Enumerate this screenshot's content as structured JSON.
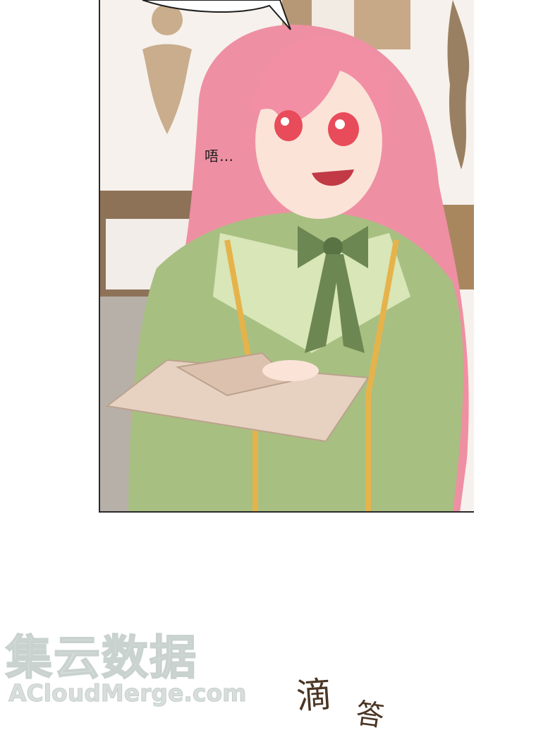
{
  "panel": {
    "mumble_text": "唔…"
  },
  "watermark": {
    "chinese": "集云数据",
    "english": "ACloudMerge.com"
  },
  "sfx": {
    "drip_1": "滴",
    "drip_2": "答"
  },
  "colors": {
    "hair": "#f08aa0",
    "uniform": "#9fb77a",
    "bow": "#6c8752",
    "envelope": "#e7d2c2",
    "trim": "#e6b34b",
    "background_wall": "#f5efe8",
    "wood": "#a98766"
  }
}
